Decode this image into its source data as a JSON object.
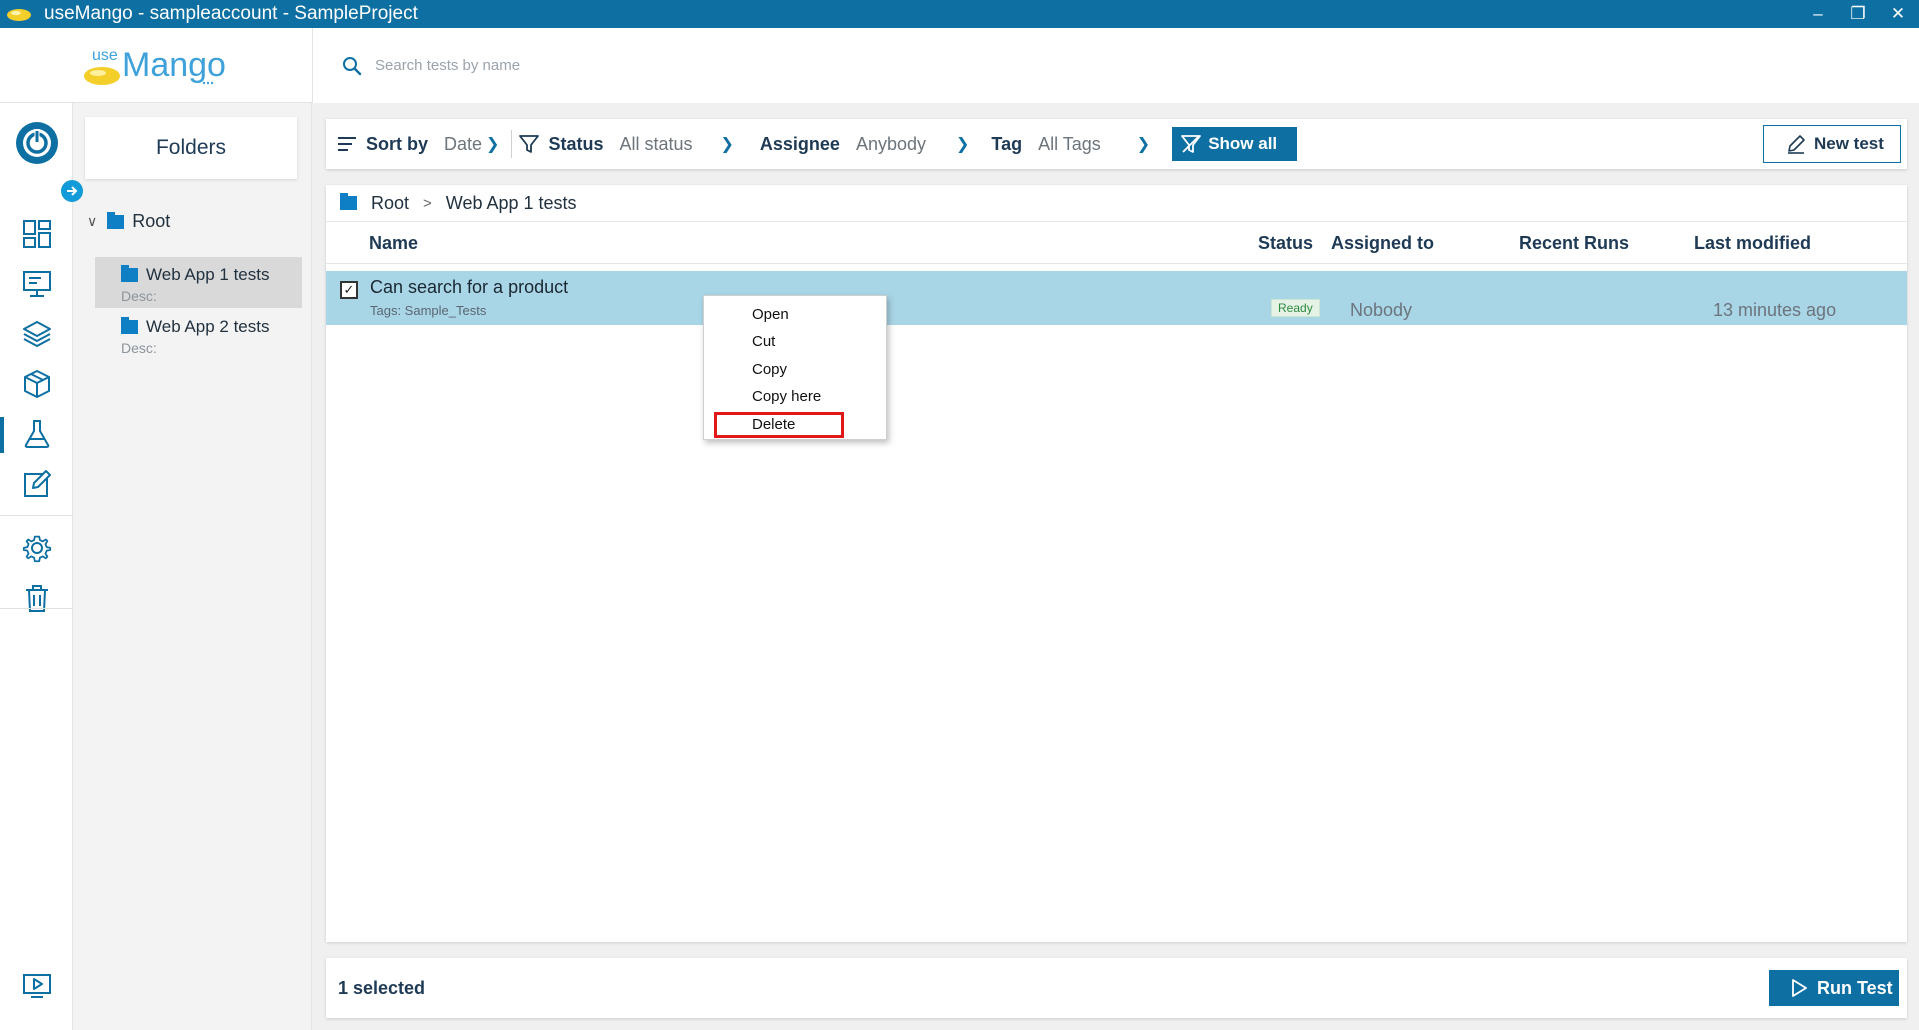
{
  "window": {
    "title": "useMango - sampleaccount - SampleProject",
    "controls": [
      "minimize-icon",
      "restore-icon",
      "close-icon"
    ]
  },
  "logo": {
    "prefix": "use",
    "name": "Mango"
  },
  "search": {
    "placeholder": "Search tests by name"
  },
  "rail": {
    "icons": [
      "power-icon",
      "dashboard-icon",
      "monitor-icon",
      "layers-icon",
      "cube-icon",
      "flask-icon",
      "edit-icon",
      "settings-icon",
      "trash-icon",
      "screen-play-icon"
    ],
    "active": "flask-icon"
  },
  "folders": {
    "header": "Folders",
    "root": "Root",
    "items": [
      {
        "name": "Web App 1 tests",
        "desc": "Desc:",
        "selected": true
      },
      {
        "name": "Web App 2 tests",
        "desc": "Desc:",
        "selected": false
      }
    ]
  },
  "filters": {
    "sort_label": "Sort by",
    "sort_value": "Date",
    "status_label": "Status",
    "status_value": "All status",
    "assignee_label": "Assignee",
    "assignee_value": "Anybody",
    "tag_label": "Tag",
    "tag_value": "All Tags",
    "show_all": "Show all",
    "new_test": "New test"
  },
  "breadcrumb": {
    "root": "Root",
    "current": "Web App 1 tests"
  },
  "table": {
    "columns": {
      "name": "Name",
      "status": "Status",
      "assigned": "Assigned to",
      "recent_runs": "Recent Runs",
      "last_modified": "Last modified"
    },
    "rows": [
      {
        "name": "Can search for a product",
        "tags": "Tags: Sample_Tests",
        "status": "Ready",
        "assigned": "Nobody",
        "recent_runs": "",
        "last_modified": "13 minutes ago",
        "checked": true
      }
    ]
  },
  "context_menu": {
    "items": [
      "Open",
      "Cut",
      "Copy",
      "Copy here",
      "Delete"
    ],
    "highlighted": "Delete"
  },
  "footer": {
    "selected": "1 selected",
    "run_test": "Run Test"
  },
  "colors": {
    "primary": "#0e6fa3",
    "accent": "#129bd8",
    "selected_row": "#a9d6e7",
    "highlight_box": "#e01818",
    "logo_yellow": "#f4cf2a"
  }
}
